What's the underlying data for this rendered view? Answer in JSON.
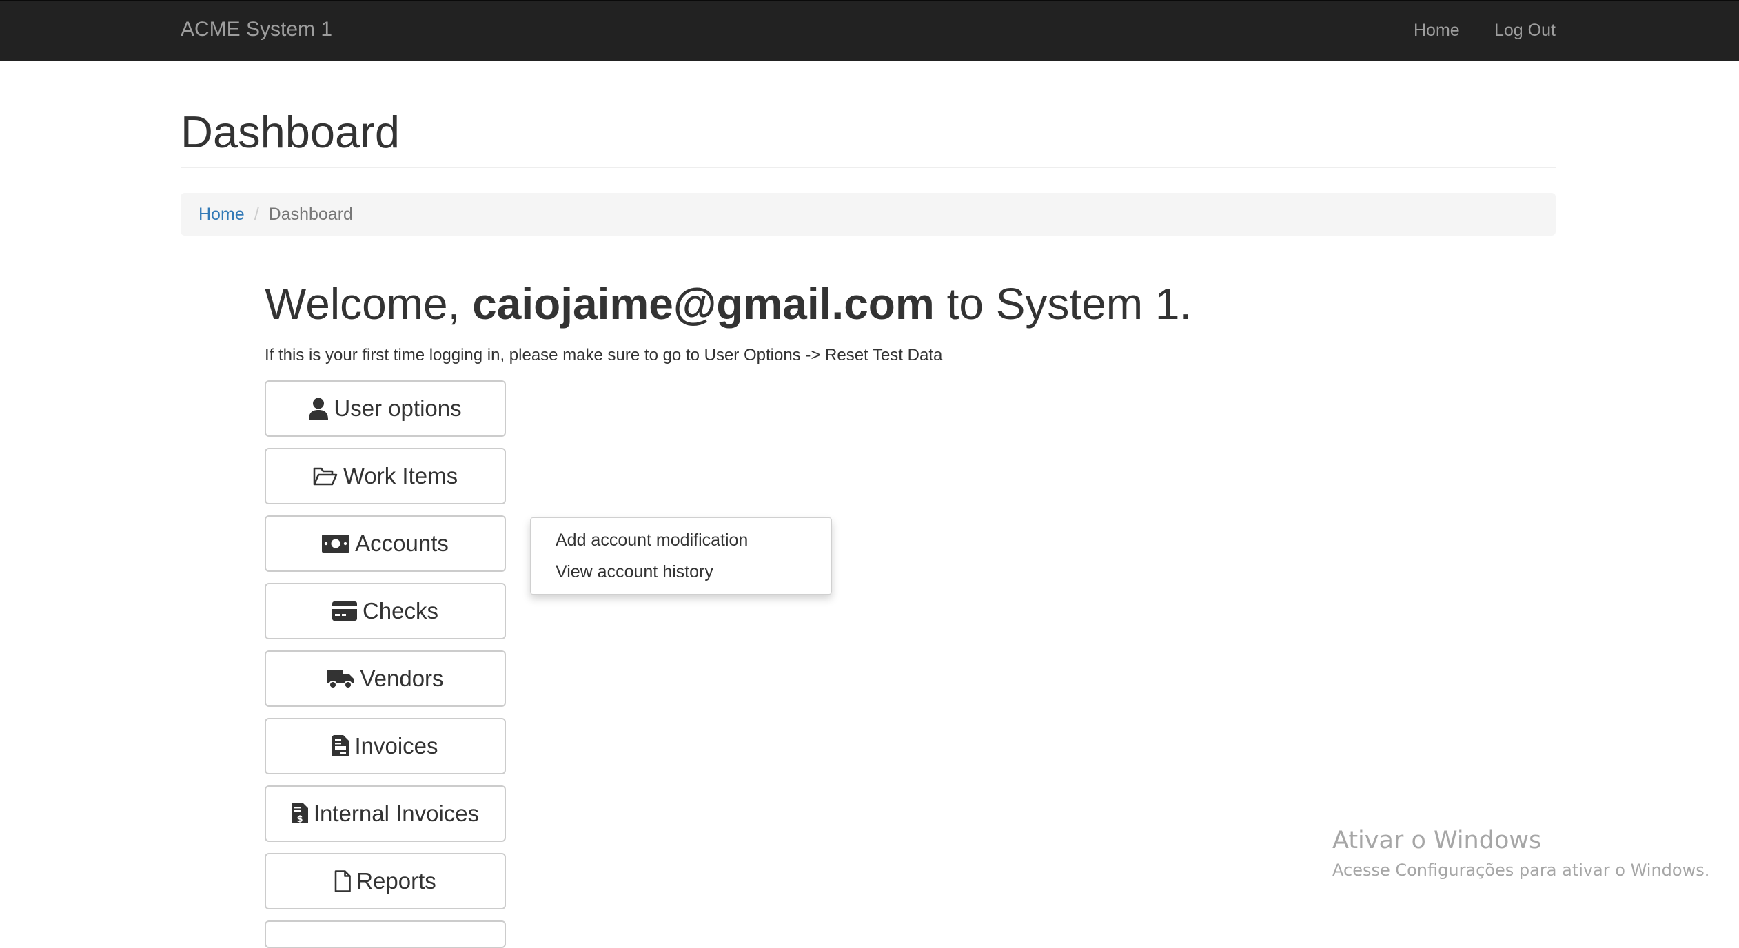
{
  "navbar": {
    "brand": "ACME System 1",
    "links": [
      {
        "label": "Home"
      },
      {
        "label": "Log Out"
      }
    ]
  },
  "page": {
    "title": "Dashboard"
  },
  "breadcrumb": {
    "home": "Home",
    "separator": "/",
    "current": "Dashboard"
  },
  "welcome": {
    "prefix": "Welcome,",
    "email": "caiojaime@gmail.com",
    "suffix": "to System 1.",
    "hint": "If this is your first time logging in, please make sure to go to User Options -> Reset Test Data"
  },
  "menu": [
    {
      "label": "User options",
      "icon": "user-icon"
    },
    {
      "label": "Work Items",
      "icon": "folder-open-icon"
    },
    {
      "label": "Accounts",
      "icon": "money-bill-icon"
    },
    {
      "label": "Checks",
      "icon": "credit-card-icon"
    },
    {
      "label": "Vendors",
      "icon": "truck-icon"
    },
    {
      "label": "Invoices",
      "icon": "file-invoice-icon"
    },
    {
      "label": "Internal Invoices",
      "icon": "file-invoice-dollar-icon"
    },
    {
      "label": "Reports",
      "icon": "file-icon"
    }
  ],
  "accounts_dropdown": {
    "items": [
      {
        "label": "Add account modification"
      },
      {
        "label": "View account history"
      }
    ]
  },
  "os_watermark": {
    "title": "Ativar o Windows",
    "subtitle": "Acesse Configurações para ativar o Windows."
  }
}
